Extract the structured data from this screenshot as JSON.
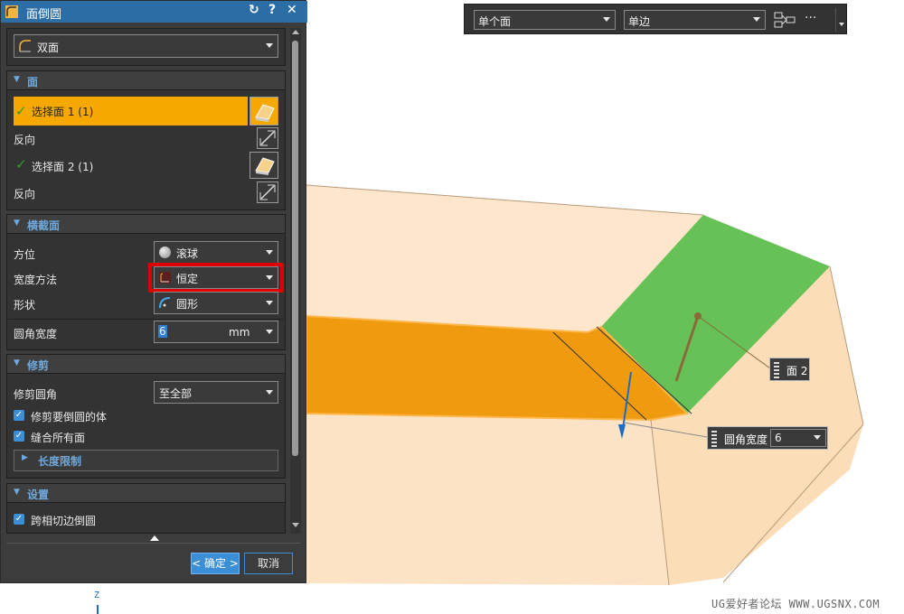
{
  "dialog": {
    "title": "面倒圆",
    "type_select": "双面",
    "sections": {
      "face": {
        "title": "面",
        "select_face_1": "选择面 1 (1)",
        "reverse_1": "反向",
        "select_face_2": "选择面 2 (1)",
        "reverse_2": "反向"
      },
      "cross_section": {
        "title": "横截面",
        "orientation_label": "方位",
        "orientation_value": "滚球",
        "width_method_label": "宽度方法",
        "width_method_value": "恒定",
        "shape_label": "形状",
        "shape_value": "圆形",
        "radius_width_label": "圆角宽度",
        "radius_width_value": "6",
        "radius_width_unit": "mm"
      },
      "trim": {
        "title": "修剪",
        "trim_fillet_label": "修剪圆角",
        "trim_fillet_value": "至全部",
        "trim_body_label": "修剪要倒圆的体",
        "stitch_faces_label": "缝合所有面",
        "length_limit_label": "长度限制"
      },
      "settings": {
        "title": "设置",
        "cross_tangent_label": "跨相切边倒圆"
      }
    },
    "ok_label": "< 确定 >",
    "cancel_label": "取消"
  },
  "toolbar": {
    "face_filter": "单个面",
    "edge_filter": "单边",
    "more": "···"
  },
  "viewport": {
    "face2_tag": "面 2",
    "width_tag_label": "圆角宽度",
    "width_tag_value": "6",
    "axis_z": "Z",
    "watermark": "UG爱好者论坛 WWW.UGSNX.COM"
  },
  "colors": {
    "title_bar": "#2b6ea5",
    "selected_row": "#f5a800",
    "highlight_red": "#e00000",
    "face_green": "#66c257",
    "face_orange": "#f09a10",
    "body": "#fce3c5"
  }
}
